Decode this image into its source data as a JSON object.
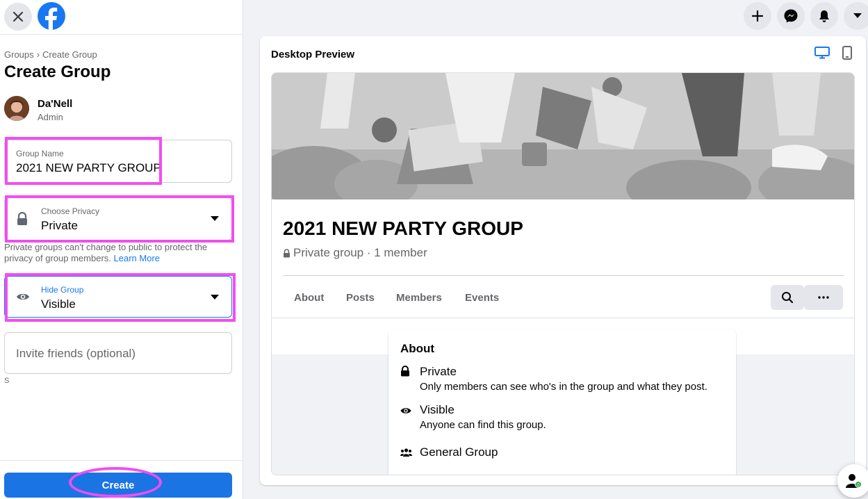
{
  "sidebar": {
    "breadcrumb": {
      "parent": "Groups",
      "separator": "›",
      "current": "Create Group"
    },
    "title": "Create Group",
    "user": {
      "name": "Da'Nell",
      "role": "Admin"
    },
    "group_name": {
      "label": "Group Name",
      "value": "2021 NEW PARTY GROUP"
    },
    "privacy": {
      "label": "Choose Privacy",
      "value": "Private"
    },
    "privacy_help": {
      "text": "Private groups can't change to public to protect the privacy of group members.",
      "link": "Learn More"
    },
    "hide_group": {
      "label": "Hide Group",
      "value": "Visible"
    },
    "invite": {
      "placeholder": "Invite friends (optional)"
    },
    "stray_char": "S",
    "create_label": "Create"
  },
  "topbar": {
    "icons": [
      "plus-icon",
      "messenger-icon",
      "notifications-icon",
      "caret-down-icon"
    ]
  },
  "preview": {
    "title": "Desktop Preview",
    "group_title": "2021 NEW PARTY GROUP",
    "group_meta": "Private group · 1 member",
    "tabs": [
      "About",
      "Posts",
      "Members",
      "Events"
    ],
    "about": {
      "title": "About",
      "privacy_title": "Private",
      "privacy_desc": "Only members can see who's in the group and what they post.",
      "visibility_title": "Visible",
      "visibility_desc": "Anyone can find this group.",
      "type_title": "General Group"
    }
  },
  "colors": {
    "accent": "#1877f2",
    "highlight": "#f24df2",
    "button": "#1b74e4"
  }
}
